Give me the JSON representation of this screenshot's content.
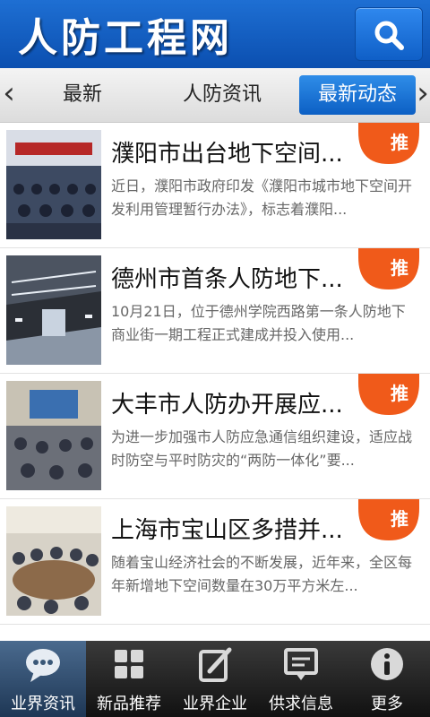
{
  "header": {
    "title": "人防工程网"
  },
  "tabs": [
    {
      "label": "最新"
    },
    {
      "label": "人防资讯"
    },
    {
      "label": "最新动态"
    }
  ],
  "articles": [
    {
      "title": "濮阳市出台地下空间...",
      "summary": "近日，濮阳市政府印发《濮阳市城市地下空间开发利用管理暂行办法》，标志着濮阳...",
      "badge": "推"
    },
    {
      "title": "德州市首条人防地下...",
      "summary": "10月21日，位于德州学院西路第一条人防地下商业街一期工程正式建成并投入使用...",
      "badge": "推"
    },
    {
      "title": "大丰市人防办开展应...",
      "summary": "为进一步加强市人防应急通信组织建设，适应战时防空与平时防灾的“两防一体化”要...",
      "badge": "推"
    },
    {
      "title": "上海市宝山区多措并...",
      "summary": "随着宝山经济社会的不断发展，近年来，全区每年新增地下空间数量在30万平方米左...",
      "badge": "推"
    }
  ],
  "bottom_nav": [
    {
      "label": "业界资讯"
    },
    {
      "label": "新品推荐"
    },
    {
      "label": "业界企业"
    },
    {
      "label": "供求信息"
    },
    {
      "label": "更多"
    }
  ],
  "colors": {
    "header_blue": "#1e6fd3",
    "badge_orange": "#f05a1a",
    "active_tab": "#1f76d8"
  }
}
